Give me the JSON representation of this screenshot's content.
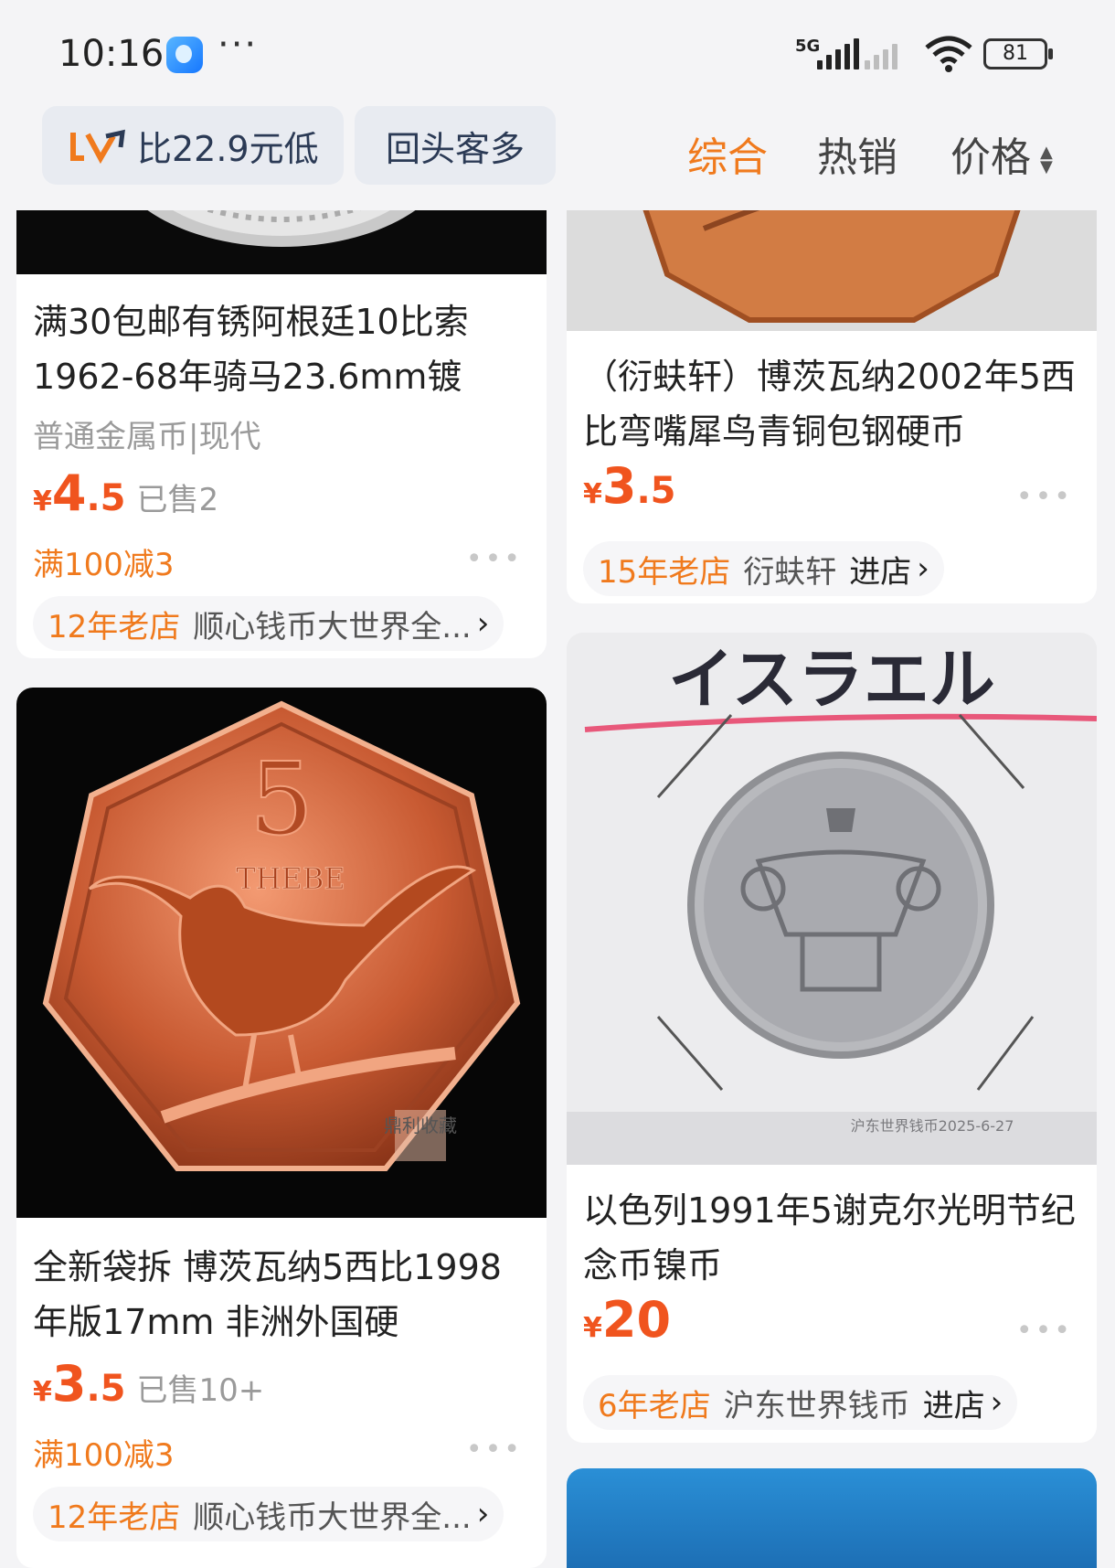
{
  "status_bar": {
    "time": "10:16",
    "network": "5G",
    "battery": "81"
  },
  "filters": {
    "price_chip": "比22.9元低",
    "repeat_chip": "回头客多"
  },
  "sort_tabs": {
    "overall": "综合",
    "hot": "热销",
    "price": "价格"
  },
  "products": [
    {
      "title": "满30包邮有锈阿根廷10比索1962-68年骑马23.6mm镀",
      "meta": "普通金属币|现代",
      "price_int": "4",
      "price_dec": ".5",
      "sold": "已售2",
      "promo": "满100减3",
      "shop_age": "12年老店",
      "shop_name": "顺心钱币大世界全...",
      "shop_enter": ""
    },
    {
      "title": "（衍蚨轩）博茨瓦纳2002年5西比弯嘴犀鸟青铜包钢硬币",
      "price_int": "3",
      "price_dec": ".5",
      "shop_age": "15年老店",
      "shop_name": "衍蚨轩",
      "shop_enter": "进店"
    },
    {
      "title": "全新袋拆 博茨瓦纳5西比1998年版17mm 非洲外国硬",
      "price_int": "3",
      "price_dec": ".5",
      "sold": "已售10+",
      "promo": "满100减3",
      "shop_age": "12年老店",
      "shop_name": "顺心钱币大世界全...",
      "shop_enter": "",
      "image_text": {
        "value": "5",
        "label": "THEBE",
        "watermark": "鼎利收藏"
      }
    },
    {
      "title": "以色列1991年5谢克尔光明节纪念币镍币",
      "price_int": "20",
      "price_dec": "",
      "shop_age": "6年老店",
      "shop_name": "沪东世界钱币",
      "shop_enter": "进店",
      "image_text": {
        "label": "イスラエル",
        "watermark": "沪东世界钱币2025-6-27"
      }
    }
  ],
  "yen": "¥",
  "more": "•••",
  "chevron": "›"
}
